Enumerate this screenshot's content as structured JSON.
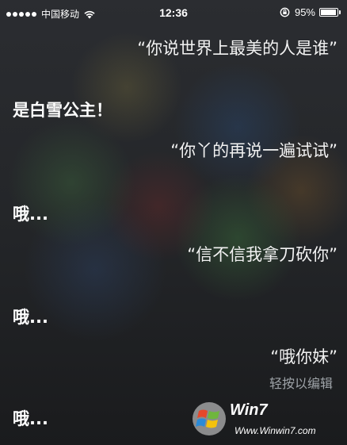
{
  "status_bar": {
    "carrier": "中国移动",
    "time": "12:36",
    "battery_percent": "95%",
    "battery_level": 0.95,
    "signal_bars": 5
  },
  "conversation": {
    "messages": [
      {
        "speaker": "user",
        "text": "“你说世界上最美的人是谁”"
      },
      {
        "speaker": "siri",
        "text": "是白雪公主！"
      },
      {
        "speaker": "user",
        "text": "“你丫的再说一遍试试”"
      },
      {
        "speaker": "siri",
        "text": "哦..."
      },
      {
        "speaker": "user",
        "text": "“信不信我拿刀砍你”"
      },
      {
        "speaker": "siri",
        "text": "哦..."
      },
      {
        "speaker": "user",
        "text": "“哦你妹”"
      },
      {
        "speaker": "siri",
        "text": "哦..."
      }
    ],
    "edit_hint": "轻按以编辑"
  },
  "watermark": {
    "brand": "Win7",
    "url": "Www.Winwin7.com"
  }
}
